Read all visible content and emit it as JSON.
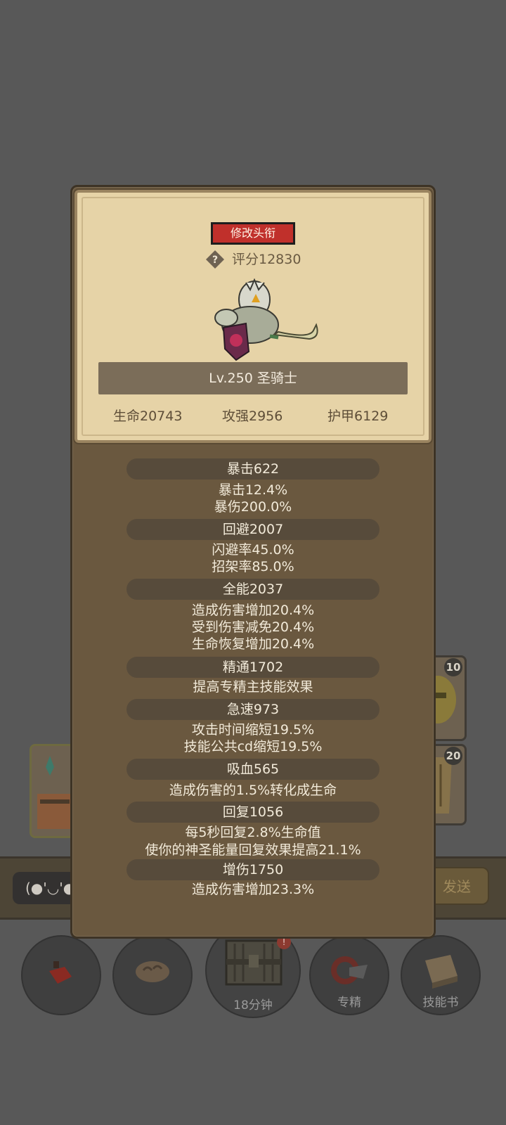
{
  "background": {
    "badges": [
      "10",
      "20"
    ],
    "chat": {
      "input_text": "(●'◡'●",
      "send_label": "发送"
    },
    "bottom_bar": [
      {
        "icon": "potion-icon",
        "label": ""
      },
      {
        "icon": "bread-icon",
        "label": ""
      },
      {
        "icon": "chest-icon",
        "label": "18分钟"
      },
      {
        "icon": "specialization-icon",
        "label": "专精"
      },
      {
        "icon": "skill-book-icon",
        "label": "技能书"
      }
    ]
  },
  "character": {
    "change_title_label": "修改头衔",
    "score": "评分12830",
    "name": "Lv.250 圣骑士",
    "stats": {
      "health": "生命20743",
      "attack": "攻强2956",
      "armor": "护甲6129"
    }
  },
  "attributes": [
    {
      "header": "暴击622",
      "lines": [
        "暴击12.4%",
        "暴伤200.0%"
      ]
    },
    {
      "header": "回避2007",
      "lines": [
        "闪避率45.0%",
        "招架率85.0%"
      ]
    },
    {
      "header": "全能2037",
      "lines": [
        "造成伤害增加20.4%",
        "受到伤害减免20.4%",
        "生命恢复增加20.4%"
      ]
    },
    {
      "header": "精通1702",
      "lines": [
        "提高专精主技能效果"
      ]
    },
    {
      "header": "急速973",
      "lines": [
        "攻击时间缩短19.5%",
        "技能公共cd缩短19.5%"
      ]
    },
    {
      "header": "吸血565",
      "lines": [
        "造成伤害的1.5%转化成生命"
      ]
    },
    {
      "header": "回复1056",
      "lines": [
        "每5秒回复2.8%生命值",
        "使你的神圣能量回复效果提高21.1%"
      ]
    },
    {
      "header": "增伤1750",
      "lines": [
        "造成伤害增加23.3%"
      ]
    }
  ],
  "colors": {
    "overlay": "#585858",
    "panel": "#6a583f",
    "card": "#e6d3a7",
    "title_button": "#c0302b",
    "name_bar": "#7b6d59"
  }
}
